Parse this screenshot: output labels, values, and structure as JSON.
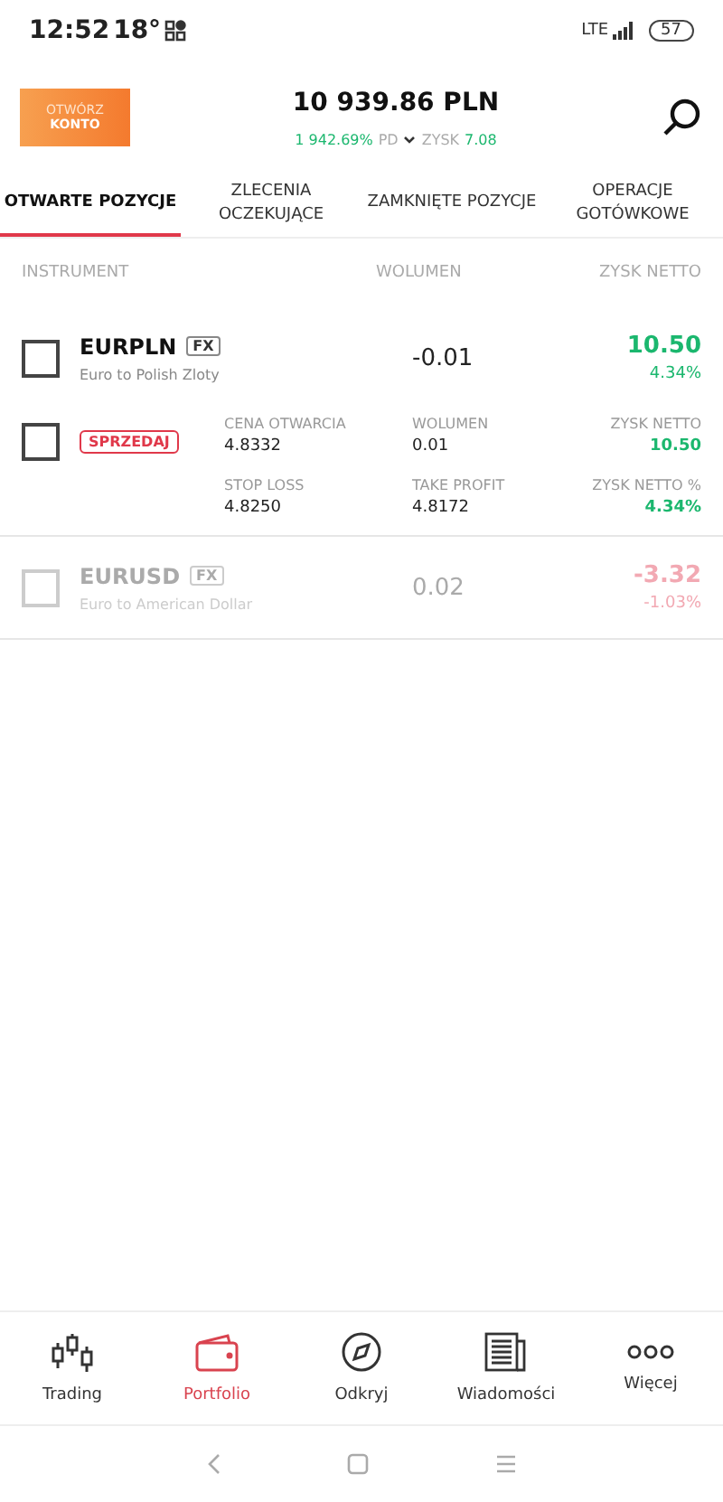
{
  "status_bar": {
    "time": "12:52",
    "temperature": "18°",
    "network": "LTE",
    "battery": "57"
  },
  "header": {
    "open_account": {
      "line_1": "OTWÓRZ",
      "line_2": "KONTO"
    },
    "balance": "10 939.86 PLN",
    "return_pct": "1 942.69%",
    "return_label": "PD",
    "profit_label": "ZYSK",
    "profit": "7.08"
  },
  "tabs": [
    {
      "label": "OTWARTE POZYCJE",
      "selected": true
    },
    {
      "label": "ZLECENIA OCZEKUJĄCE",
      "selected": false
    },
    {
      "label": "ZAMKNIĘTE POZYCJE",
      "selected": false
    },
    {
      "label": "OPERACJE GOTÓWKOWE",
      "selected": false
    }
  ],
  "columns": [
    "INSTRUMENT",
    "WOLUMEN",
    "ZYSK NETTO"
  ],
  "positions": [
    {
      "symbol": "EURPLN",
      "tag": "FX",
      "description": "Euro to Polish Zloty",
      "volume": "-0.01",
      "profit": "10.50",
      "profit_pct": "4.34%",
      "color": "#1bb76e",
      "checked": false,
      "dimmed": false,
      "expanded": true,
      "details": {
        "side": "SPRZEDAJ",
        "checked": false,
        "fields": [
          {
            "label": "CENA OTWARCIA",
            "value": "4.8332"
          },
          {
            "label": "WOLUMEN",
            "value": "0.01"
          },
          {
            "label": "ZYSK NETTO",
            "value": "10.50",
            "kind": "profit"
          },
          {
            "label": "STOP LOSS",
            "value": "4.8250"
          },
          {
            "label": "TAKE PROFIT",
            "value": "4.8172"
          },
          {
            "label": "ZYSK NETTO %",
            "value": "4.34%",
            "kind": "profit"
          }
        ]
      }
    },
    {
      "symbol": "EURUSD",
      "tag": "FX",
      "description": "Euro to American Dollar",
      "volume": "0.02",
      "profit": "-3.32",
      "profit_pct": "-1.03%",
      "color": "#f2a9b3",
      "checked": false,
      "dimmed": true,
      "expanded": false
    }
  ],
  "bottom_nav": [
    {
      "label": "Trading",
      "selected": false
    },
    {
      "label": "Portfolio",
      "selected": true
    },
    {
      "label": "Odkryj",
      "selected": false
    },
    {
      "label": "Wiadomości",
      "selected": false
    },
    {
      "label": "Więcej",
      "selected": false
    }
  ]
}
